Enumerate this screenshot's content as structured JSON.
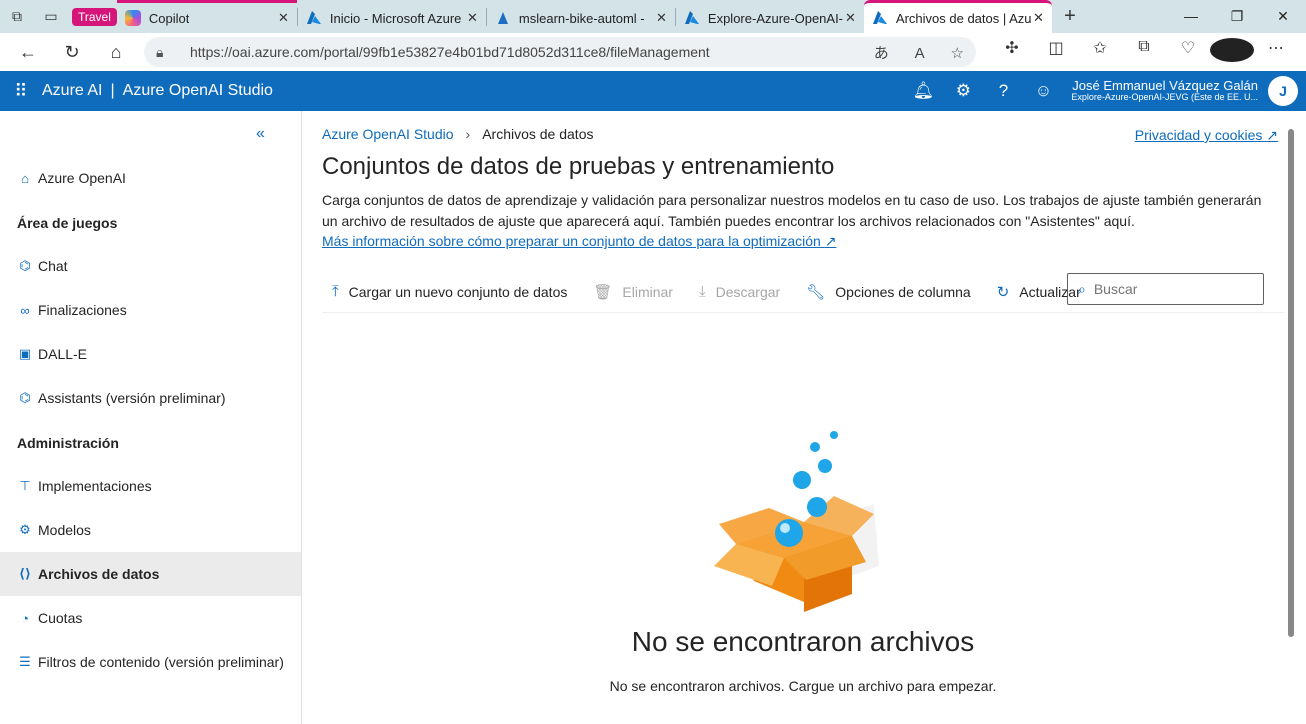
{
  "browser": {
    "tab_group": "Travel",
    "tabs": [
      {
        "title": "Copilot"
      },
      {
        "title": "Inicio - Microsoft Azure"
      },
      {
        "title": "mslearn-bike-automl -"
      },
      {
        "title": "Explore-Azure-OpenAI-"
      },
      {
        "title": "Archivos de datos | Azu"
      }
    ],
    "url": "https://oai.azure.com/portal/99fb1e53827e4b01bd71d8052d311ce8/fileManagement"
  },
  "header": {
    "brand": "Azure AI",
    "separator": "|",
    "product": "Azure OpenAI Studio",
    "user_name": "José Emmanuel Vázquez Galán",
    "user_tenant": "Explore-Azure-OpenAI-JEVG (Este de EE. U...",
    "avatar_initial": "J"
  },
  "sidebar": {
    "items": [
      {
        "label": "Azure OpenAI",
        "icon": "home-icon"
      },
      {
        "heading": "Área de juegos"
      },
      {
        "label": "Chat",
        "icon": "chat-icon"
      },
      {
        "label": "Finalizaciones",
        "icon": "completions-icon"
      },
      {
        "label": "DALL-E",
        "icon": "image-icon"
      },
      {
        "label": "Assistants (versión preliminar)",
        "icon": "assistants-icon"
      },
      {
        "heading": "Administración"
      },
      {
        "label": "Implementaciones",
        "icon": "deployments-icon"
      },
      {
        "label": "Modelos",
        "icon": "models-icon"
      },
      {
        "label": "Archivos de datos",
        "icon": "data-files-icon",
        "selected": true
      },
      {
        "label": "Cuotas",
        "icon": "quota-icon"
      },
      {
        "label": "Filtros de contenido (versión preliminar)",
        "icon": "content-filter-icon"
      }
    ]
  },
  "main": {
    "breadcrumb_root": "Azure OpenAI Studio",
    "breadcrumb_current": "Archivos de datos",
    "privacy_link": "Privacidad y cookies",
    "title": "Conjuntos de datos de pruebas y entrenamiento",
    "description": "Carga conjuntos de datos de aprendizaje y validación para personalizar nuestros modelos en tu caso de uso. Los trabajos de ajuste también generarán un archivo de resultados de ajuste que aparecerá aquí. También puedes encontrar los archivos relacionados con \"Asistentes\" aquí.",
    "learn_more": "Más información sobre cómo preparar un conjunto de datos para la optimización",
    "toolbar": {
      "upload": "Cargar un nuevo conjunto de datos",
      "delete": "Eliminar",
      "download": "Descargar",
      "columns": "Opciones de columna",
      "refresh": "Actualizar",
      "search_placeholder": "Buscar"
    },
    "empty_title": "No se encontraron archivos",
    "empty_subtitle": "No se encontraron archivos. Cargue un archivo para empezar."
  },
  "colors": {
    "azure_blue": "#0f6cbd",
    "tab_group": "#d6157a",
    "box_orange": "#f39c1f"
  }
}
